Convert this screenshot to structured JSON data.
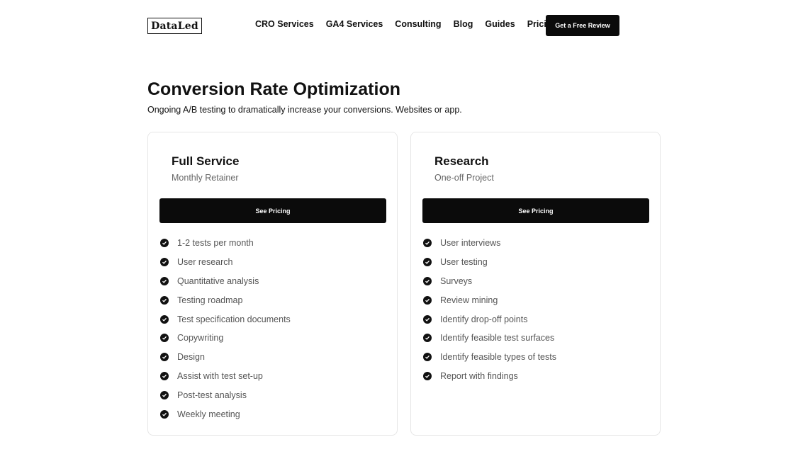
{
  "header": {
    "logo": "DataLed",
    "nav": [
      "CRO Services",
      "GA4 Services",
      "Consulting",
      "Blog",
      "Guides",
      "Pricing"
    ],
    "cta": "Get a Free Review"
  },
  "page": {
    "title": "Conversion Rate Optimization",
    "subtitle": "Ongoing A/B testing to dramatically increase your conversions. Websites or app."
  },
  "cards": [
    {
      "title": "Full Service",
      "subtitle": "Monthly Retainer",
      "button": "See Pricing",
      "items": [
        "1-2 tests per month",
        "User research",
        "Quantitative analysis",
        "Testing roadmap",
        "Test specification documents",
        "Copywriting",
        "Design",
        "Assist with test set-up",
        "Post-test analysis",
        "Weekly meeting"
      ]
    },
    {
      "title": "Research",
      "subtitle": "One-off Project",
      "button": "See Pricing",
      "items": [
        "User interviews",
        "User testing",
        "Surveys",
        "Review mining",
        "Identify drop-off points",
        "Identify feasible test surfaces",
        "Identify feasible types of tests",
        "Report with findings"
      ]
    }
  ],
  "icons": {
    "list": "check-circle-icon"
  }
}
